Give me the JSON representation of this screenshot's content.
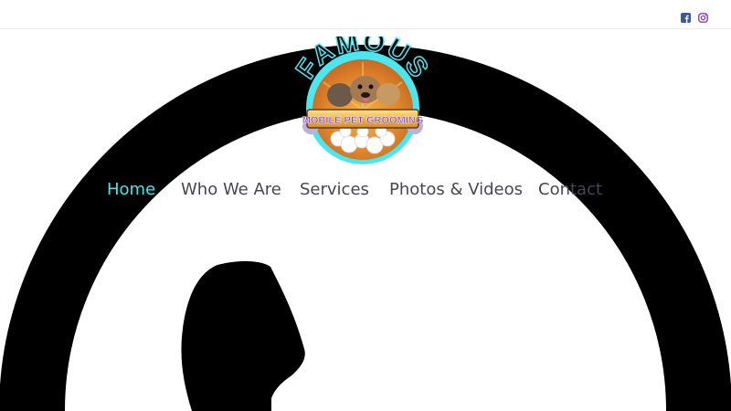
{
  "header": {
    "social": [
      {
        "icon": "facebook-icon",
        "color": "#3b5998"
      },
      {
        "icon": "instagram-icon",
        "color": "#8a3ab9"
      }
    ]
  },
  "logo": {
    "wordmark": "FAMOUS",
    "tagline": "MOBILE PET GROOMING"
  },
  "nav": {
    "items": [
      {
        "label": "Home",
        "active": true
      },
      {
        "label": "Who We Are",
        "active": false
      },
      {
        "label": "Services",
        "active": false
      },
      {
        "label": "Photos & Videos",
        "active": false
      },
      {
        "label": "Contact",
        "active": false
      }
    ],
    "active_color": "#44e6ee",
    "text_color": "#46474f"
  },
  "hero": {
    "background": "phone-outline-graphic"
  }
}
